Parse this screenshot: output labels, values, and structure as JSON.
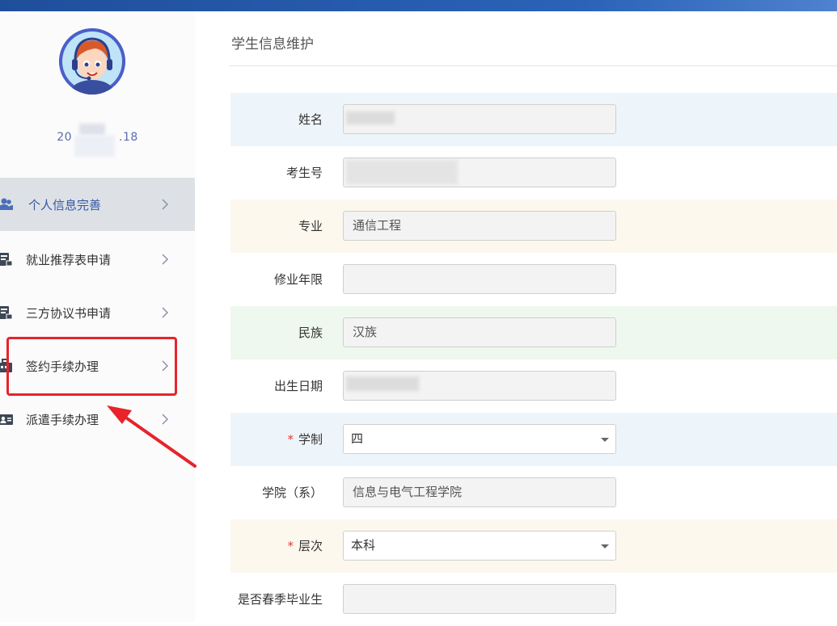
{
  "user": {
    "id_visible_start": "20",
    "id_visible_end": ".18"
  },
  "sidebar": {
    "items": [
      {
        "label": "个人信息完善",
        "icon": "users-icon",
        "active": true
      },
      {
        "label": "就业推荐表申请",
        "icon": "document-stamp-icon",
        "active": false
      },
      {
        "label": "三方协议书申请",
        "icon": "document-stamp-icon",
        "active": false
      },
      {
        "label": "签约手续办理",
        "icon": "briefcase-icon",
        "active": false
      },
      {
        "label": "派遣手续办理",
        "icon": "id-card-icon",
        "active": false
      }
    ]
  },
  "page": {
    "title": "学生信息维护"
  },
  "form": {
    "rows": [
      {
        "label": "姓名",
        "value": "",
        "required": false,
        "type": "text",
        "bg": "#eef5fa"
      },
      {
        "label": "考生号",
        "value": "",
        "required": false,
        "type": "text",
        "bg": "#ffffff"
      },
      {
        "label": "专业",
        "value": "通信工程",
        "required": false,
        "type": "text",
        "bg": "#fcf8ee"
      },
      {
        "label": "修业年限",
        "value": "",
        "required": false,
        "type": "text",
        "bg": "#ffffff"
      },
      {
        "label": "民族",
        "value": "汉族",
        "required": false,
        "type": "text",
        "bg": "#eef8ee"
      },
      {
        "label": "出生日期",
        "value": "",
        "required": false,
        "type": "text",
        "bg": "#ffffff"
      },
      {
        "label": "学制",
        "value": "四",
        "required": true,
        "type": "select",
        "bg": "#eef5fa"
      },
      {
        "label": "学院（系）",
        "value": "信息与电气工程学院",
        "required": false,
        "type": "text",
        "bg": "#ffffff"
      },
      {
        "label": "层次",
        "value": "本科",
        "required": true,
        "type": "select",
        "bg": "#fcf8ee"
      },
      {
        "label": "是否春季毕业生",
        "value": "",
        "required": false,
        "type": "text",
        "bg": "#ffffff"
      }
    ]
  },
  "colors": {
    "topbar": "#2a63b8",
    "active_nav_bg": "#dde1e6",
    "active_nav_text": "#3558a6",
    "annotation_red": "#e8232a",
    "required_star": "#e53935"
  }
}
